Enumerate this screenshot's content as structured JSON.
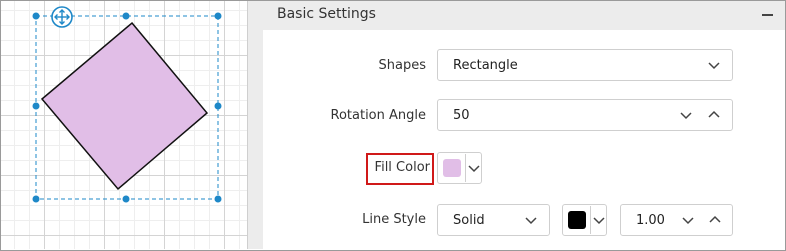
{
  "settings": {
    "title": "Basic Settings",
    "shapes": {
      "label": "Shapes",
      "value": "Rectangle"
    },
    "rotation": {
      "label": "Rotation Angle",
      "value": "50"
    },
    "fill": {
      "label": "Fill Color",
      "color": "#e1bee7"
    },
    "line": {
      "label": "Line Style",
      "style": "Solid",
      "color": "#000000",
      "width": "1.00"
    }
  },
  "colors": {
    "highlight": "#d01919",
    "selection": "#1e88c8",
    "shape_fill": "#e1bee7",
    "shape_stroke": "#111111"
  },
  "icons": [
    "move-icon",
    "collapse-icon",
    "chevron-down-icon",
    "chevron-up-icon"
  ]
}
